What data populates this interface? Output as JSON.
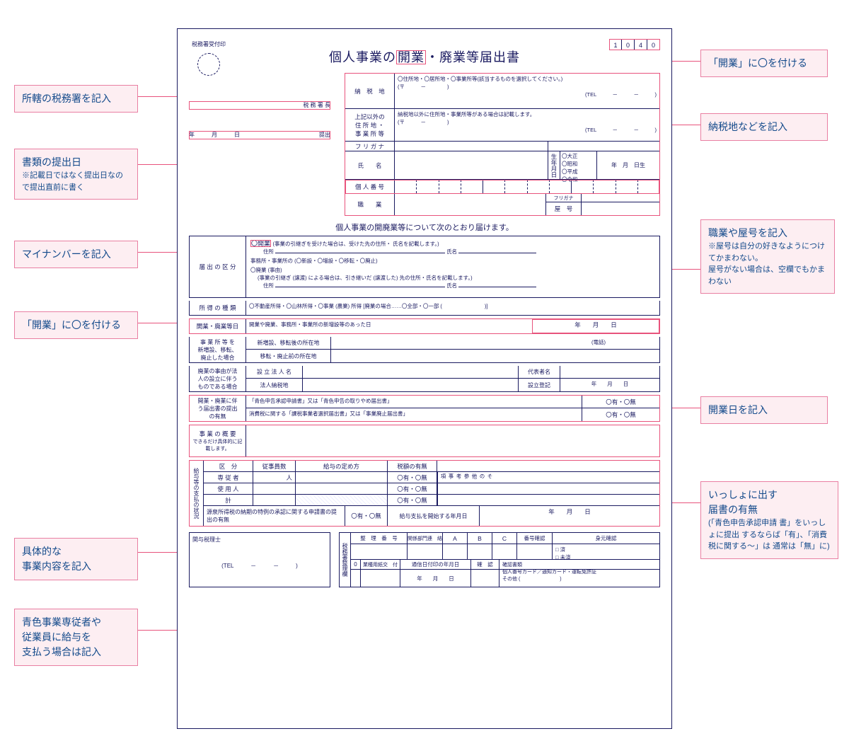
{
  "callouts": {
    "left1": {
      "t": "所轄の税務署を記入"
    },
    "left2": {
      "t": "書類の提出日",
      "s": "※記載日ではなく提出日なので提出直前に書く"
    },
    "left3": {
      "t": "マイナンバーを記入"
    },
    "left4": {
      "t": "「開業」に〇を付ける"
    },
    "left5": {
      "t": "具体的な\n事業内容を記入"
    },
    "left6": {
      "t": "青色事業専従者や\n従業員に給与を\n支払う場合は記入"
    },
    "right1": {
      "t": "「開業」に〇を付ける"
    },
    "right2": {
      "t": "納税地などを記入"
    },
    "right3": {
      "t": "職業や屋号を記入",
      "s": "※屋号は自分の好きなようにつけてかまわない。\n屋号がない場合は、空欄でもかまわない"
    },
    "right4": {
      "t": "開業日を記入"
    },
    "right5": {
      "t": "いっしょに出す\n届書の有無",
      "s": "(「青色申告承認申請 書」をいっしょに提出 するならば「有」、「消費税に関する〜」は 通常は「無」に)"
    }
  },
  "form": {
    "stamp": "税務署受付印",
    "code": [
      "1",
      "0",
      "4",
      "0"
    ],
    "title_pre": "個人事業の",
    "title_hl": "開業",
    "title_post": "・廃業等届出書",
    "office_suffix": "税 務 署 長",
    "date_line": "年　　　月　　　日",
    "date_suffix": "提出",
    "nouzei_lbl": "納　税　地",
    "nouzei_opts": "〇住所地・〇居所地・〇事業所等(該当するものを選択してください。)",
    "postal": "(〒　　　－　　　　)",
    "tel": "(TEL　　　－　　　－　　　)",
    "addr2_lbl": "上記以外の\n住 所 地 ・\n事 業 所 等",
    "addr2_note": "納税地以外に住所地・事業所等がある場合は記載します。",
    "furigana": "フ リ ガ ナ",
    "name_lbl": "氏　　名",
    "birth_lbl": "生年月日",
    "era_opts": "〇大正\n〇昭和\n〇平成\n〇令和",
    "birth_val": "年　月　日生",
    "mynum_lbl": "個 人 番 号",
    "job_lbl": "職　　業",
    "yago_furi": "フリガナ",
    "yago_lbl": "屋　号",
    "subtitle": "個人事業の開廃業等について次のとおり届けます。",
    "kubun_lbl": "届 出 の 区 分",
    "kubun_open": "〇開業",
    "kubun_open_note": "(事業の引継ぎを受けた場合は、受けた先の住所・ 氏名を記載します。)",
    "kubun_addr": "住所",
    "kubun_name": "氏名",
    "kubun_office": "事務所・事業所の (〇新設・〇増設・〇移転・〇廃止)",
    "kubun_close": "〇廃業 (事由)",
    "kubun_close_note": "(事業の引継ぎ (譲渡) による場合は、引き継いだ (譲渡した) 先の住所・氏名を記載します。)",
    "income_lbl": "所 得 の 種 類",
    "income_opts": "〇不動産所得・〇山林所得・〇事業 (農業) 所得 [廃業の場合……〇全部・〇一部 (　　　　　　　　)]",
    "opendate_lbl": "開業・廃業等日",
    "opendate_txt": "開業や廃業、事務所・事業所の新増設等のあった日",
    "opendate_val": "年　　月　　日",
    "move_lbl": "事 業 所 等 を\n新増設、移転、\n廃止した場合",
    "move_new": "新増設、移転後の所在地",
    "move_tel": "(電話)",
    "move_old": "移転・廃止前の所在地",
    "corp_lbl": "廃業の事由が法\n人の設立に伴う\nものである場合",
    "corp_name": "設 立 法 人 名",
    "corp_rep": "代表者名",
    "corp_addr": "法人納税地",
    "corp_reg": "設立登記",
    "corp_date": "年　　月　　日",
    "attach_lbl": "開業・廃業に伴\nう届出書の提出\nの有無",
    "attach1": "「青色申告承認申請書」又は「青色申告の取りやめ届出書」",
    "attach2": "消費税に関する「課税事業者選択届出書」又は「事業廃止届出書」",
    "yesno": "〇有・〇無",
    "summary_lbl": "事 業 の 概 要",
    "summary_note": "できるだけ具体的に記載します。",
    "pay_lbl": "給与等の支払の状況",
    "pay_cols": [
      "区　分",
      "従事員数",
      "給与の定め方",
      "税額の有無"
    ],
    "pay_rows": [
      "専 従 者",
      "使 用 人",
      "計"
    ],
    "pay_unit": "人",
    "pay_other": "その他参考事項",
    "withhold": "源泉所得税の納期の特例の承認に関する申請書の提出の有無",
    "paystart": "給与支払を開始する年月日",
    "paystart_val": "年　　月　　日",
    "zeirishi": "関与税理士",
    "foot_tax": "税務署整理欄",
    "foot_cols": [
      "整　理　番　号",
      "関係部門連　絡",
      "A",
      "B",
      "C",
      "番号確認",
      "身元確認"
    ],
    "foot_check": "□ 済\n□ 未済",
    "foot_0": "0",
    "foot_paper": "業種用紙交　付",
    "foot_tsushin": "通信日付印の年月日",
    "foot_kakunin": "確　認",
    "foot_docs": "確認書類\n個人番号カード／通知カード・運転免許証\nその他 (　　　　　　　　)"
  }
}
